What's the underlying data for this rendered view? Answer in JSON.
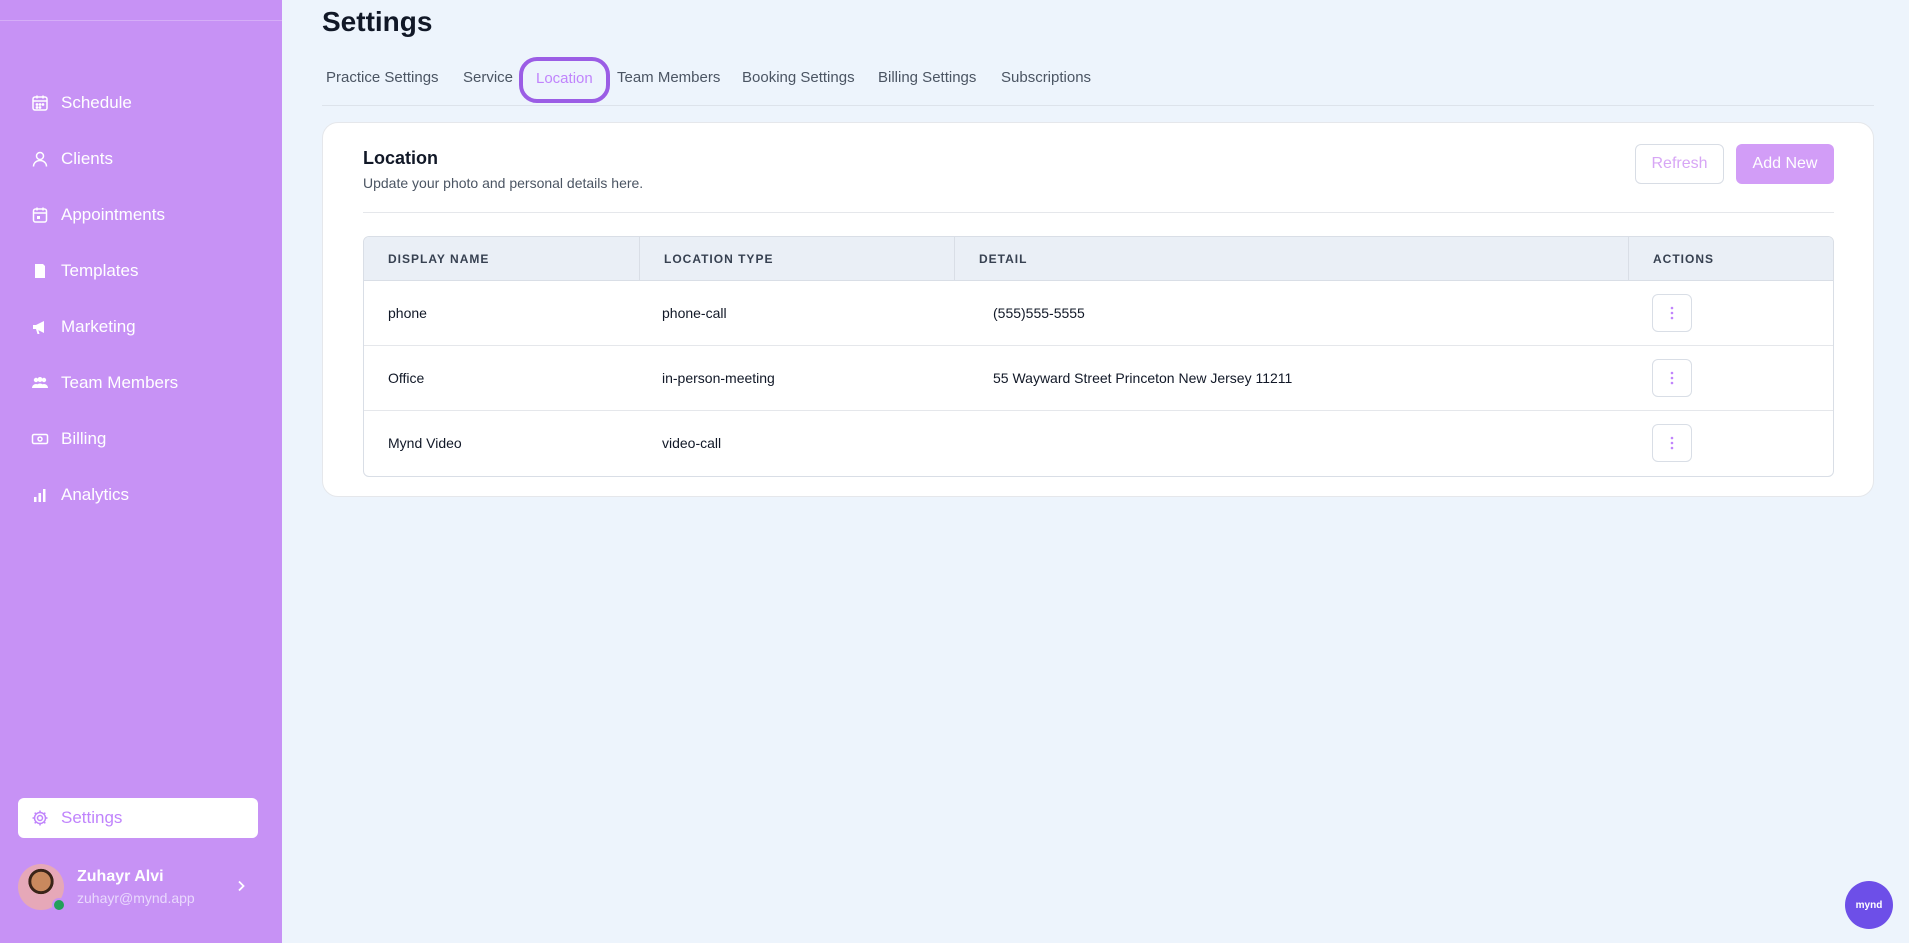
{
  "sidebar": {
    "items": [
      {
        "label": "Schedule",
        "icon": "calendar-icon"
      },
      {
        "label": "Clients",
        "icon": "user-icon"
      },
      {
        "label": "Appointments",
        "icon": "calendar-check-icon"
      },
      {
        "label": "Templates",
        "icon": "document-icon"
      },
      {
        "label": "Marketing",
        "icon": "megaphone-icon"
      },
      {
        "label": "Team Members",
        "icon": "team-icon"
      },
      {
        "label": "Billing",
        "icon": "cash-icon"
      },
      {
        "label": "Analytics",
        "icon": "chart-bar-icon"
      }
    ],
    "settings_label": "Settings",
    "user": {
      "name": "Zuhayr Alvi",
      "email": "zuhayr@mynd.app"
    }
  },
  "page": {
    "title": "Settings"
  },
  "tabs": [
    {
      "label": "Practice Settings"
    },
    {
      "label": "Service"
    },
    {
      "label": "Location",
      "active": true
    },
    {
      "label": "Team Members"
    },
    {
      "label": "Booking Settings"
    },
    {
      "label": "Billing Settings"
    },
    {
      "label": "Subscriptions"
    }
  ],
  "card": {
    "title": "Location",
    "subtitle": "Update your photo and personal details here.",
    "refresh_label": "Refresh",
    "add_label": "Add New"
  },
  "table": {
    "headers": [
      "DISPLAY NAME",
      "LOCATION TYPE",
      "DETAIL",
      "ACTIONS"
    ],
    "rows": [
      {
        "display_name": "phone",
        "location_type": "phone-call",
        "detail": "(555)555-5555"
      },
      {
        "display_name": "Office",
        "location_type": "in-person-meeting",
        "detail": "55 Wayward Street Princeton New Jersey 11211"
      },
      {
        "display_name": "Mynd Video",
        "location_type": "video-call",
        "detail": ""
      }
    ]
  },
  "widget": {
    "label": "mynd"
  },
  "colors": {
    "sidebar": "#c792f5",
    "accent": "#c084fc",
    "background": "#edf4fc",
    "widget": "#6d4fe8"
  }
}
